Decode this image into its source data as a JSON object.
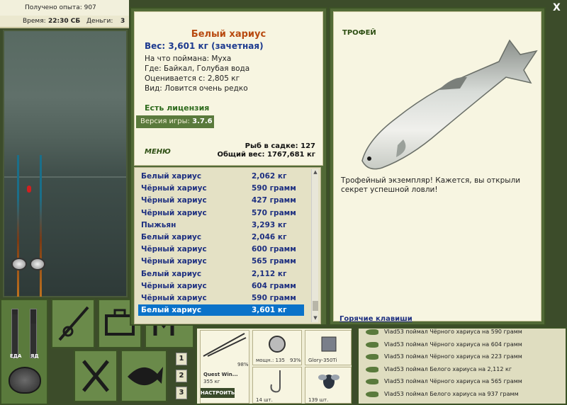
{
  "status": {
    "experience": "Получено опыта: 907",
    "time_label": "Время:",
    "time_value": "22:30 СБ",
    "money_label": "Деньги:",
    "money_value": "3"
  },
  "meters": {
    "food_label": "ЕДА",
    "energy_label": "ЯД"
  },
  "fish": {
    "title": "Белый хариус",
    "weight": "Вес: 3,601 кг (зачетная)",
    "caught_with": "На что поймана: Муха",
    "location": "Где: Байкал, Голубая вода",
    "price": "Оценивается с: 2,805 кг",
    "rarity": "Вид: Ловится очень редко"
  },
  "license": "Есть лицензия",
  "version": {
    "label": "Версия игры:",
    "value": "3.7.6"
  },
  "menu": "МЕНЮ",
  "stats": {
    "in_keepnet": "Рыб в садке: 127",
    "total_weight": "Общий вес: 1767,681 кг"
  },
  "catches": [
    {
      "name": "Белый хариус",
      "weight": "2,062 кг"
    },
    {
      "name": "Чёрный хариус",
      "weight": "590 грамм"
    },
    {
      "name": "Чёрный хариус",
      "weight": "427 грамм"
    },
    {
      "name": "Чёрный хариус",
      "weight": "570 грамм"
    },
    {
      "name": "Пыжьян",
      "weight": "3,293 кг"
    },
    {
      "name": "Белый хариус",
      "weight": "2,046 кг"
    },
    {
      "name": "Чёрный хариус",
      "weight": "600 грамм"
    },
    {
      "name": "Чёрный хариус",
      "weight": "565 грамм"
    },
    {
      "name": "Белый хариус",
      "weight": "2,112 кг"
    },
    {
      "name": "Чёрный хариус",
      "weight": "604 грамм"
    },
    {
      "name": "Чёрный хариус",
      "weight": "590 грамм"
    },
    {
      "name": "Белый хариус",
      "weight": "3,601 кг"
    }
  ],
  "trophy": {
    "tag": "ТРОФЕЙ",
    "text": "Трофейный экземпляр! Кажется, вы открыли секрет успешной ловли!",
    "hotkeys": "Горячие клавиши"
  },
  "close": "X",
  "tabs": [
    "1",
    "2",
    "3"
  ],
  "equipment": {
    "rod_name": "Quest Win...",
    "rod_weight": "355 кг",
    "rod_pct": "98%",
    "reel_label": "мощн.: 135",
    "reel_pct": "93%",
    "line_name": "Glory-350Ti",
    "hook_count": "14 шт.",
    "bait_count": "139 шт.",
    "tune": "НАСТРОИТЬ"
  },
  "chat": [
    "Vlad53 поймал Чёрного хариуса на 590 грамм",
    "Vlad53 поймал Чёрного хариуса на 604 грамм",
    "Vlad53 поймал Чёрного хариуса на 223 грамм",
    "Vlad53 поймал Белого хариуса на 2,112 кг",
    "Vlad53 поймал Чёрного хариуса на 565 грамм",
    "Vlad53 поймал Белого хариуса на 937 грамм"
  ],
  "colors": {
    "accent_green": "#526a36",
    "selected": "#0a72c9",
    "title_orange": "#b84a10",
    "list_blue": "#1d2f80"
  }
}
